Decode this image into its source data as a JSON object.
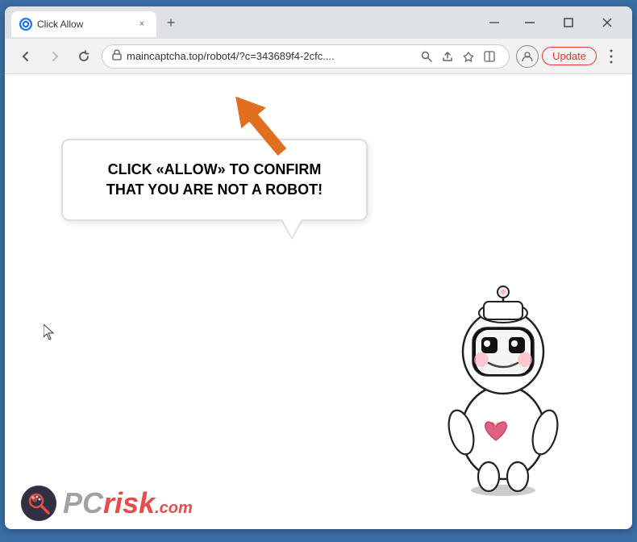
{
  "browser": {
    "tab": {
      "title": "Click Allow",
      "favicon": "🌐",
      "close_label": "×"
    },
    "new_tab_label": "+",
    "window_controls": {
      "minimize": "─",
      "maximize": "□",
      "close": "✕"
    },
    "nav": {
      "back_label": "←",
      "forward_label": "→",
      "reload_label": "↺",
      "url": "maincaptcha.top/robot4/?c=343689f4-2cfc....",
      "lock_icon": "🔒",
      "search_icon": "🔍",
      "share_icon": "⎋",
      "bookmark_icon": "☆",
      "split_icon": "▣",
      "profile_icon": "👤",
      "update_label": "Update",
      "menu_icon": "⋮"
    }
  },
  "page": {
    "bubble_text": "CLICK «ALLOW» TO CONFIRM THAT YOU ARE NOT A ROBOT!",
    "arrow_direction": "up-right"
  },
  "watermark": {
    "text_pc": "PC",
    "text_risk": "risk",
    "text_com": ".com"
  }
}
